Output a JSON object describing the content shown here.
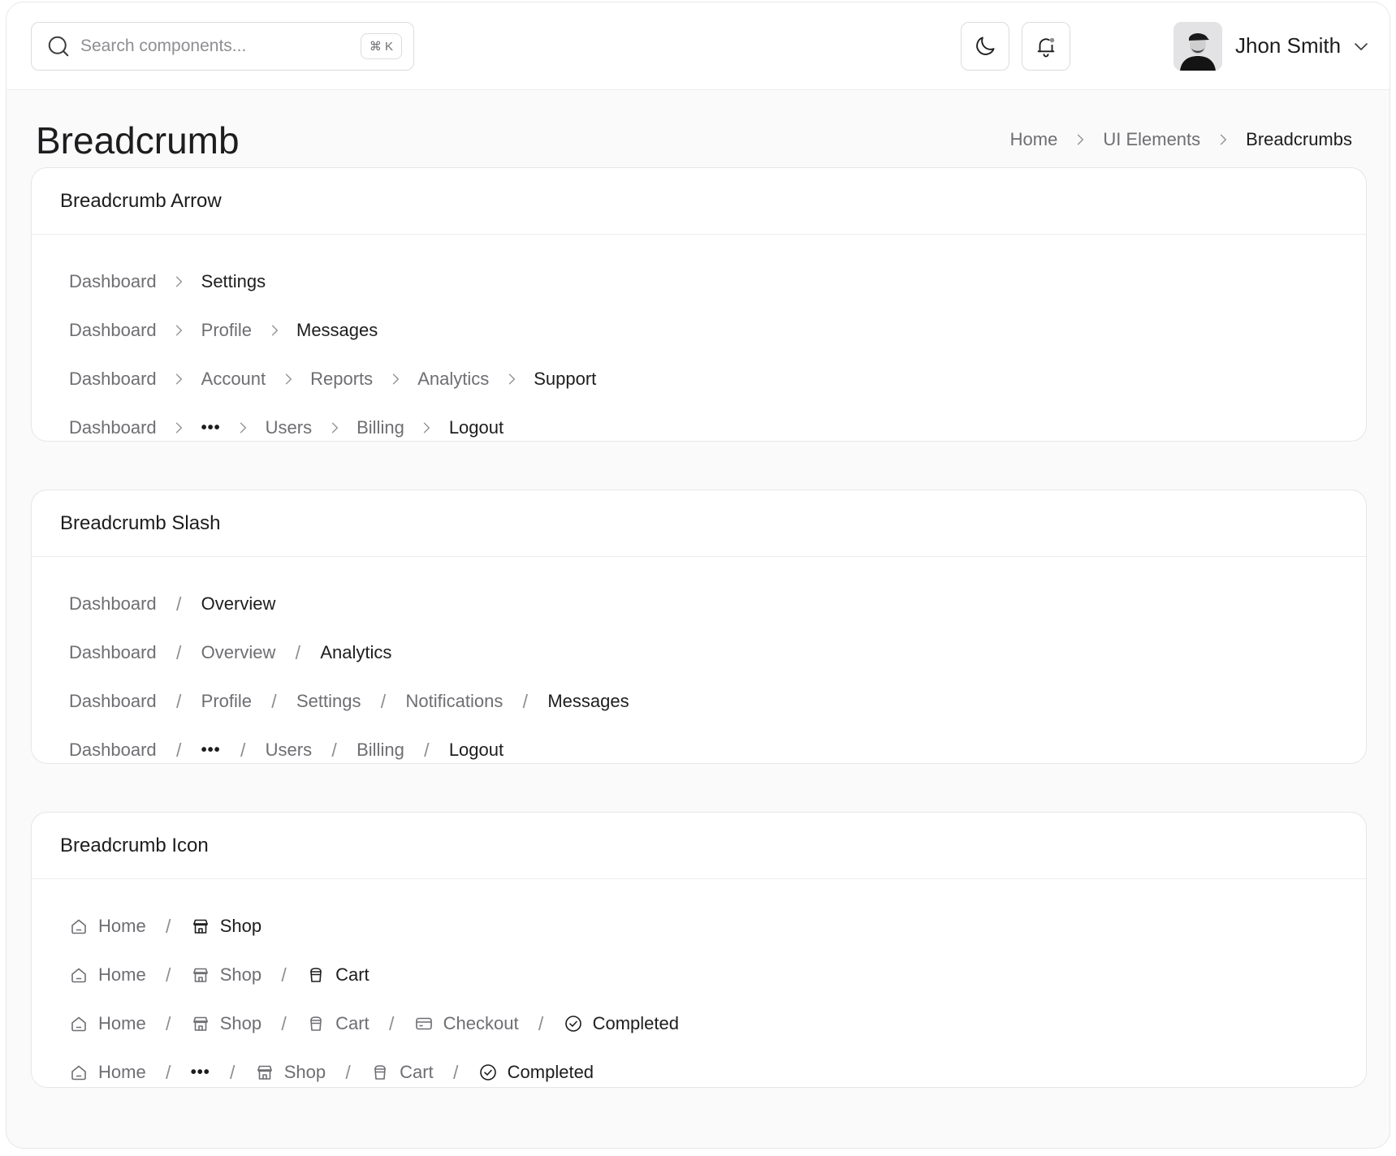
{
  "search": {
    "placeholder": "Search components...",
    "shortcut": "⌘ K"
  },
  "header": {
    "theme_icon": "moon-icon",
    "notification_icon": "bell-icon",
    "user_name": "Jhon Smith"
  },
  "page": {
    "title": "Breadcrumb",
    "breadcrumbs": [
      "Home",
      "UI Elements",
      "Breadcrumbs"
    ]
  },
  "cards": {
    "arrow": {
      "title": "Breadcrumb Arrow",
      "rows": [
        [
          "Dashboard",
          "Settings"
        ],
        [
          "Dashboard",
          "Profile",
          "Messages"
        ],
        [
          "Dashboard",
          "Account",
          "Reports",
          "Analytics",
          "Support"
        ],
        [
          "Dashboard",
          "...",
          "Users",
          "Billing",
          "Logout"
        ]
      ]
    },
    "slash": {
      "title": "Breadcrumb Slash",
      "rows": [
        [
          "Dashboard",
          "Overview"
        ],
        [
          "Dashboard",
          "Overview",
          "Analytics"
        ],
        [
          "Dashboard",
          "Profile",
          "Settings",
          "Notifications",
          "Messages"
        ],
        [
          "Dashboard",
          "...",
          "Users",
          "Billing",
          "Logout"
        ]
      ]
    },
    "icon": {
      "title": "Breadcrumb Icon",
      "rows": [
        [
          {
            "label": "Home",
            "icon": "home-icon"
          },
          {
            "label": "Shop",
            "icon": "shop-icon"
          }
        ],
        [
          {
            "label": "Home",
            "icon": "home-icon"
          },
          {
            "label": "Shop",
            "icon": "shop-icon"
          },
          {
            "label": "Cart",
            "icon": "cart-icon"
          }
        ],
        [
          {
            "label": "Home",
            "icon": "home-icon"
          },
          {
            "label": "Shop",
            "icon": "shop-icon"
          },
          {
            "label": "Cart",
            "icon": "cart-icon"
          },
          {
            "label": "Checkout",
            "icon": "credit-card-icon"
          },
          {
            "label": "Completed",
            "icon": "check-circle-icon"
          }
        ],
        [
          {
            "label": "Home",
            "icon": "home-icon"
          },
          {
            "label": "...",
            "icon": ""
          },
          {
            "label": "Shop",
            "icon": "shop-icon"
          },
          {
            "label": "Cart",
            "icon": "cart-icon"
          },
          {
            "label": "Completed",
            "icon": "check-circle-icon"
          }
        ]
      ]
    }
  },
  "colors": {
    "muted_text": "#6e6e73",
    "strong_text": "#1d1d1f",
    "border": "#e6e6e9"
  }
}
